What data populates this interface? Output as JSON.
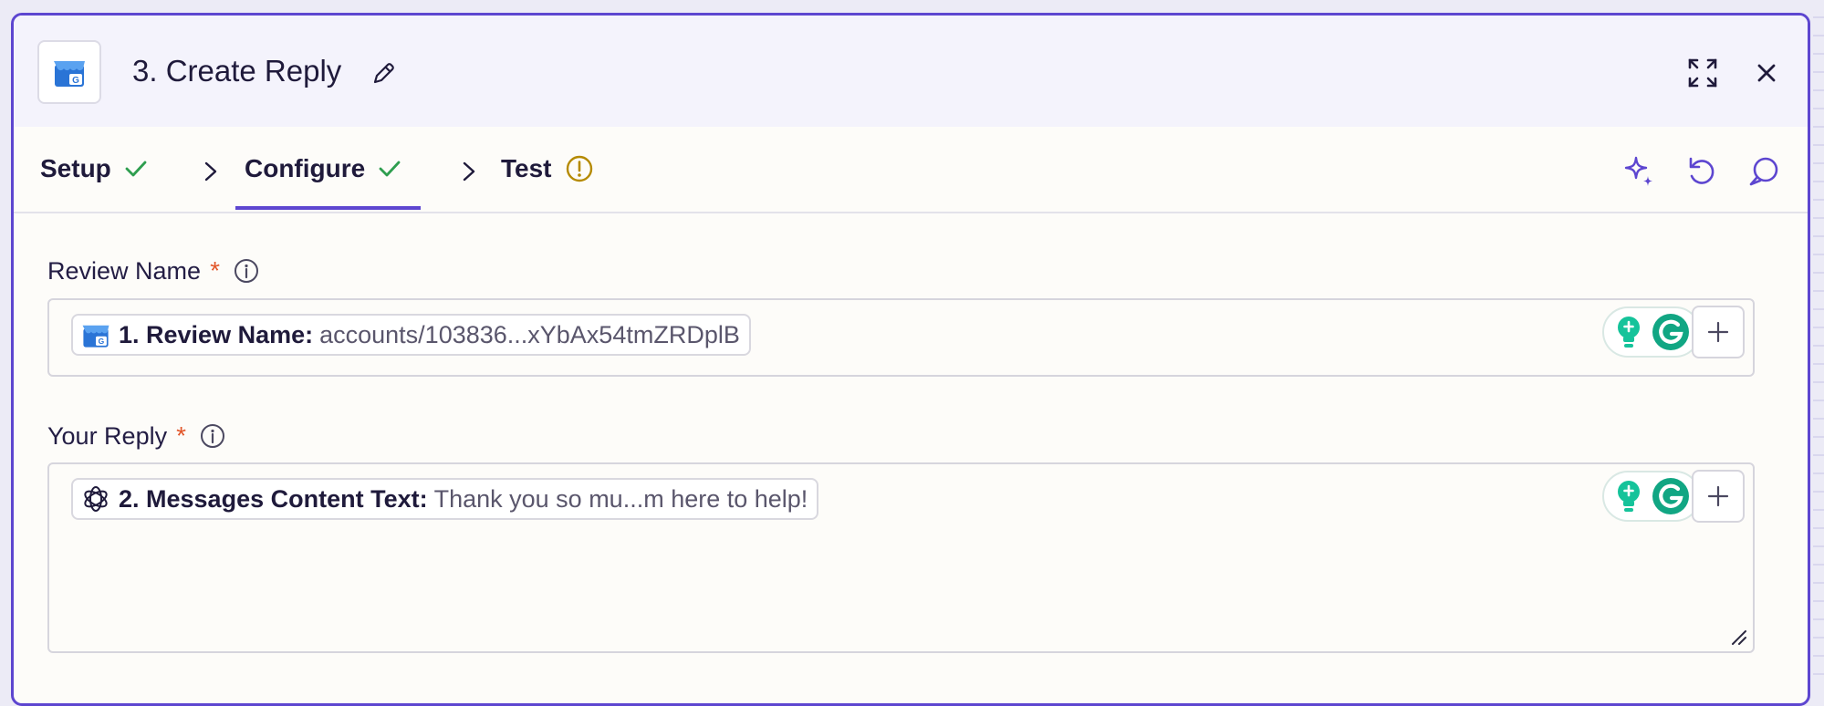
{
  "header": {
    "title": "3. Create Reply"
  },
  "tabs": [
    {
      "label": "Setup",
      "status": "complete"
    },
    {
      "label": "Configure",
      "status": "complete",
      "active": true
    },
    {
      "label": "Test",
      "status": "warning"
    }
  ],
  "fields": {
    "review_name": {
      "label": "Review Name",
      "required_mark": "*",
      "pill_key": "1. Review Name:",
      "pill_value": "accounts/103836...xYbAx54tmZRDplB"
    },
    "your_reply": {
      "label": "Your Reply",
      "required_mark": "*",
      "pill_key": "2. Messages Content Text:",
      "pill_value": "Thank you so mu...m here to help!"
    }
  },
  "icons": {
    "app": "google-business-store-icon",
    "openai": "openai-icon",
    "grammarly": "grammarly-icon",
    "assist": "sparkle-icon",
    "refresh": "refresh-icon",
    "comment": "comment-icon"
  },
  "colors": {
    "accent": "#5d46d0",
    "success": "#2e9e4f",
    "warning": "#b58a00",
    "required": "#e2572b",
    "grammarly": "#15c39a"
  }
}
